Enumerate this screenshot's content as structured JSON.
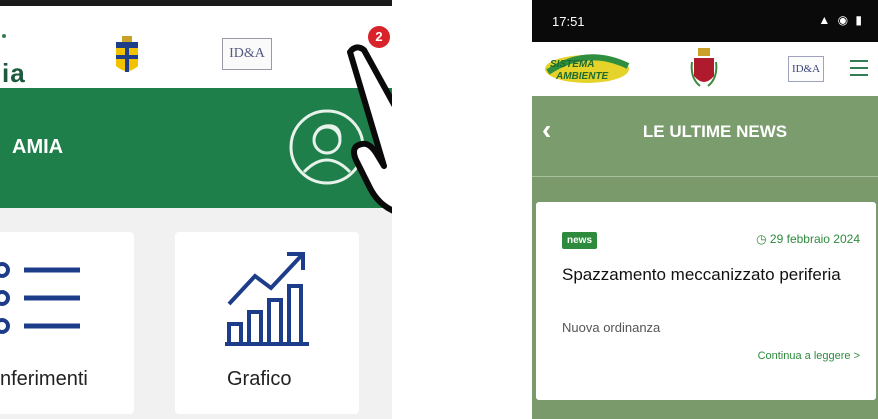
{
  "left": {
    "brand_fragment": "ia",
    "badge_count": "2",
    "ida_logo": "ID&A",
    "bar_title": "AMIA",
    "tiles": [
      {
        "label": "nferimenti",
        "icon": "list-icon"
      },
      {
        "label": "Grafico",
        "icon": "bar-chart-icon"
      }
    ]
  },
  "right": {
    "status": {
      "time": "17:51",
      "icons": "▲ ◉ ▮"
    },
    "appbar": {
      "logo": "SISTEMA AMBIENTE",
      "ida_logo": "ID&A"
    },
    "page_title": "LE ULTIME NEWS",
    "news": {
      "tag": "news",
      "date": "29 febbraio 2024",
      "title": "Spazzamento meccanizzato periferia",
      "subtitle": "Nuova ordinanza",
      "link": "Continua a leggere >"
    }
  },
  "colors": {
    "green_primary": "#1f7f4a",
    "phone_bg": "#7a9a6c",
    "badge_red": "#d8232a"
  }
}
